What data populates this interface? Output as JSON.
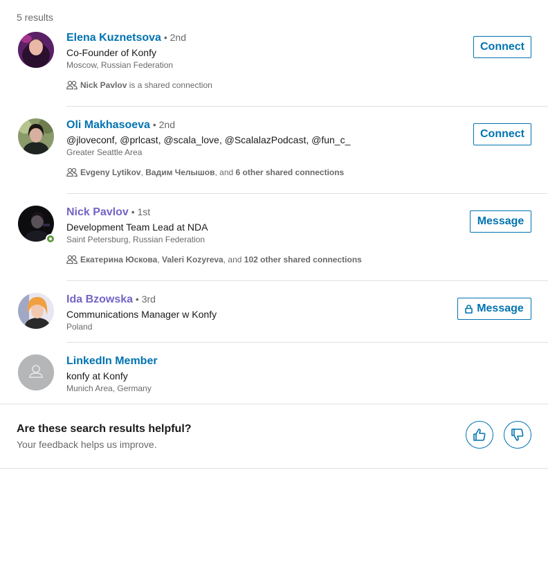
{
  "results_count": "5 results",
  "results": [
    {
      "name": "Elena Kuznetsova",
      "degree": " • 2nd",
      "headline": "Co-Founder of Konfy",
      "location": "Moscow, Russian Federation",
      "shared": [
        {
          "bold": "Nick Pavlov"
        },
        {
          "text": " is a shared connection"
        }
      ],
      "action": "Connect"
    },
    {
      "name": "Oli Makhasoeva",
      "degree": " • 2nd",
      "headline": "@jloveconf, @prlcast, @scala_love, @ScalalazPodcast, @fun_c_",
      "location": "Greater Seattle Area",
      "shared": [
        {
          "bold": "Evgeny Lytikov"
        },
        {
          "text": ", "
        },
        {
          "bold": "Вадим Челышов"
        },
        {
          "text": ", and "
        },
        {
          "bold": "6 other shared connections"
        }
      ],
      "action": "Connect"
    },
    {
      "name": "Nick Pavlov",
      "degree": " • 1st",
      "headline": "Development Team Lead at NDA",
      "location": "Saint Petersburg, Russian Federation",
      "shared": [
        {
          "bold": "Екатерина Юскова"
        },
        {
          "text": ", "
        },
        {
          "bold": "Valeri Kozyreva"
        },
        {
          "text": ", and "
        },
        {
          "bold": "102 other shared connections"
        }
      ],
      "action": "Message"
    },
    {
      "name": "Ida Bzowska",
      "degree": " • 3rd",
      "headline": "Communications Manager w Konfy",
      "location": "Poland",
      "action": "Message"
    },
    {
      "name": "LinkedIn Member",
      "degree": "",
      "headline": "konfy at Konfy",
      "location": "Munich Area, Germany"
    }
  ],
  "feedback": {
    "title": "Are these search results helpful?",
    "subtitle": "Your feedback helps us improve."
  },
  "colors": {
    "link_blue": "#0073b1",
    "visited_purple": "#7264c6",
    "online_green": "#5f9b41"
  }
}
